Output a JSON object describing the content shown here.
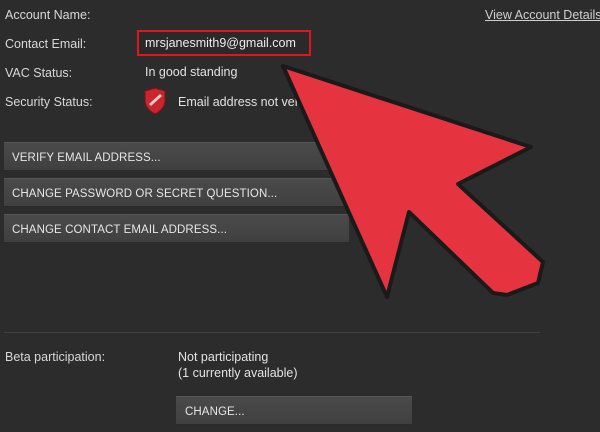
{
  "account": {
    "name_label": "Account Name:",
    "email_label": "Contact Email:",
    "email_value": "mrsjanesmith9@gmail.com",
    "vac_label": "VAC Status:",
    "vac_value": "In good standing",
    "security_label": "Security Status:",
    "security_value": "Email address not verified",
    "view_details_link": "View Account Details"
  },
  "buttons": {
    "verify_email": "VERIFY EMAIL ADDRESS...",
    "change_password": "CHANGE PASSWORD OR SECRET QUESTION...",
    "change_email": "CHANGE CONTACT EMAIL ADDRESS..."
  },
  "beta": {
    "label": "Beta participation:",
    "status_line1": "Not participating",
    "status_line2": "(1 currently available)",
    "change_button": "CHANGE..."
  },
  "colors": {
    "background": "#2c2c2c",
    "highlight_box": "#e0161d",
    "arrow_fill": "#e5343f",
    "arrow_stroke": "#1a1a1a",
    "shield": "#c8262c"
  },
  "icons": {
    "security": "shield-warning-icon",
    "pointer": "red-arrow-annotation"
  }
}
